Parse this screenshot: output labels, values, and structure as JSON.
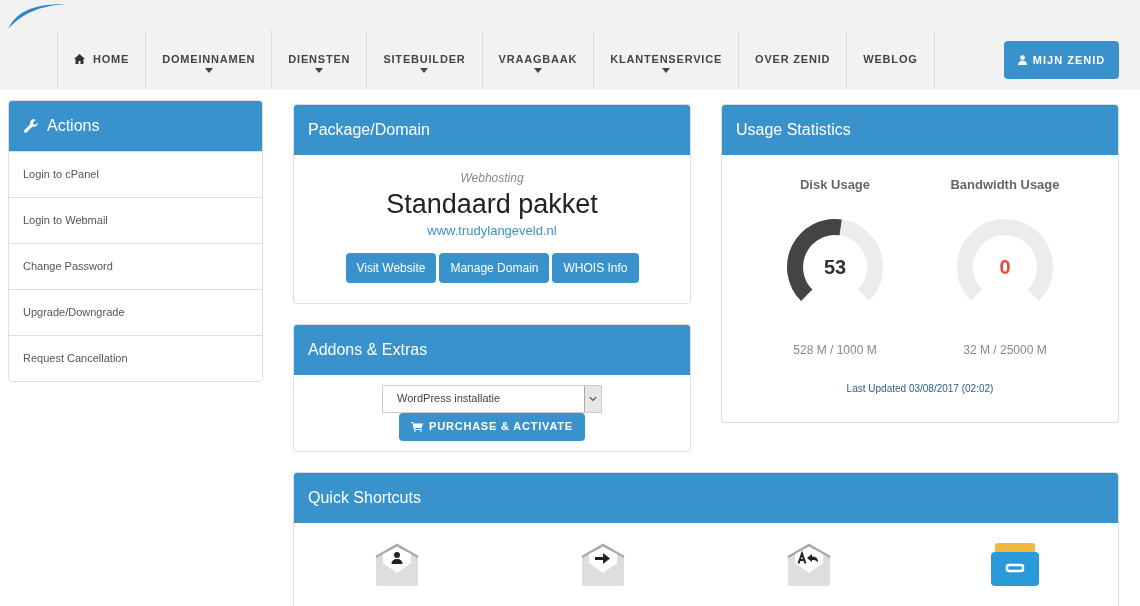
{
  "nav": {
    "items": [
      {
        "label": "HOME",
        "kind": "home",
        "dropdown": false
      },
      {
        "label": "DOMEINNAMEN",
        "kind": "plain",
        "dropdown": true
      },
      {
        "label": "DIENSTEN",
        "kind": "plain",
        "dropdown": true
      },
      {
        "label": "SITEBUILDER",
        "kind": "plain",
        "dropdown": true
      },
      {
        "label": "VRAAGBAAK",
        "kind": "plain",
        "dropdown": true
      },
      {
        "label": "KLANTENSERVICE",
        "kind": "plain",
        "dropdown": true
      },
      {
        "label": "OVER ZENID",
        "kind": "plain",
        "dropdown": false
      },
      {
        "label": "WEBLOG",
        "kind": "plain",
        "dropdown": false
      }
    ],
    "account_button": "MIJN ZENID"
  },
  "actions": {
    "title": "Actions",
    "items": [
      "Login to cPanel",
      "Login to Webmail",
      "Change Password",
      "Upgrade/Downgrade",
      "Request Cancellation"
    ]
  },
  "package": {
    "title": "Package/Domain",
    "type": "Webhosting",
    "name": "Standaard pakket",
    "domain": "www.trudylangeveld.nl",
    "buttons": [
      "Visit Website",
      "Manage Domain",
      "WHOIS Info"
    ]
  },
  "addons": {
    "title": "Addons & Extras",
    "select_value": "WordPress installatie",
    "button": "PURCHASE & ACTIVATE"
  },
  "usage": {
    "title": "Usage Statistics",
    "gauges": [
      {
        "label": "Disk Usage",
        "value": "53",
        "level": 0.53,
        "color": "#333333",
        "reading": "528 M / 1000 M"
      },
      {
        "label": "Bandwidth Usage",
        "value": "0",
        "color": "#e74c3c",
        "reading": "32 M / 25000 M"
      }
    ],
    "last_updated": "Last Updated 03/08/2017 (02:02)"
  },
  "shortcuts": {
    "title": "Quick Shortcuts",
    "items": [
      {
        "kind": "mail-person"
      },
      {
        "kind": "mail-forward"
      },
      {
        "kind": "mail-reply"
      },
      {
        "kind": "drawer"
      }
    ]
  }
}
